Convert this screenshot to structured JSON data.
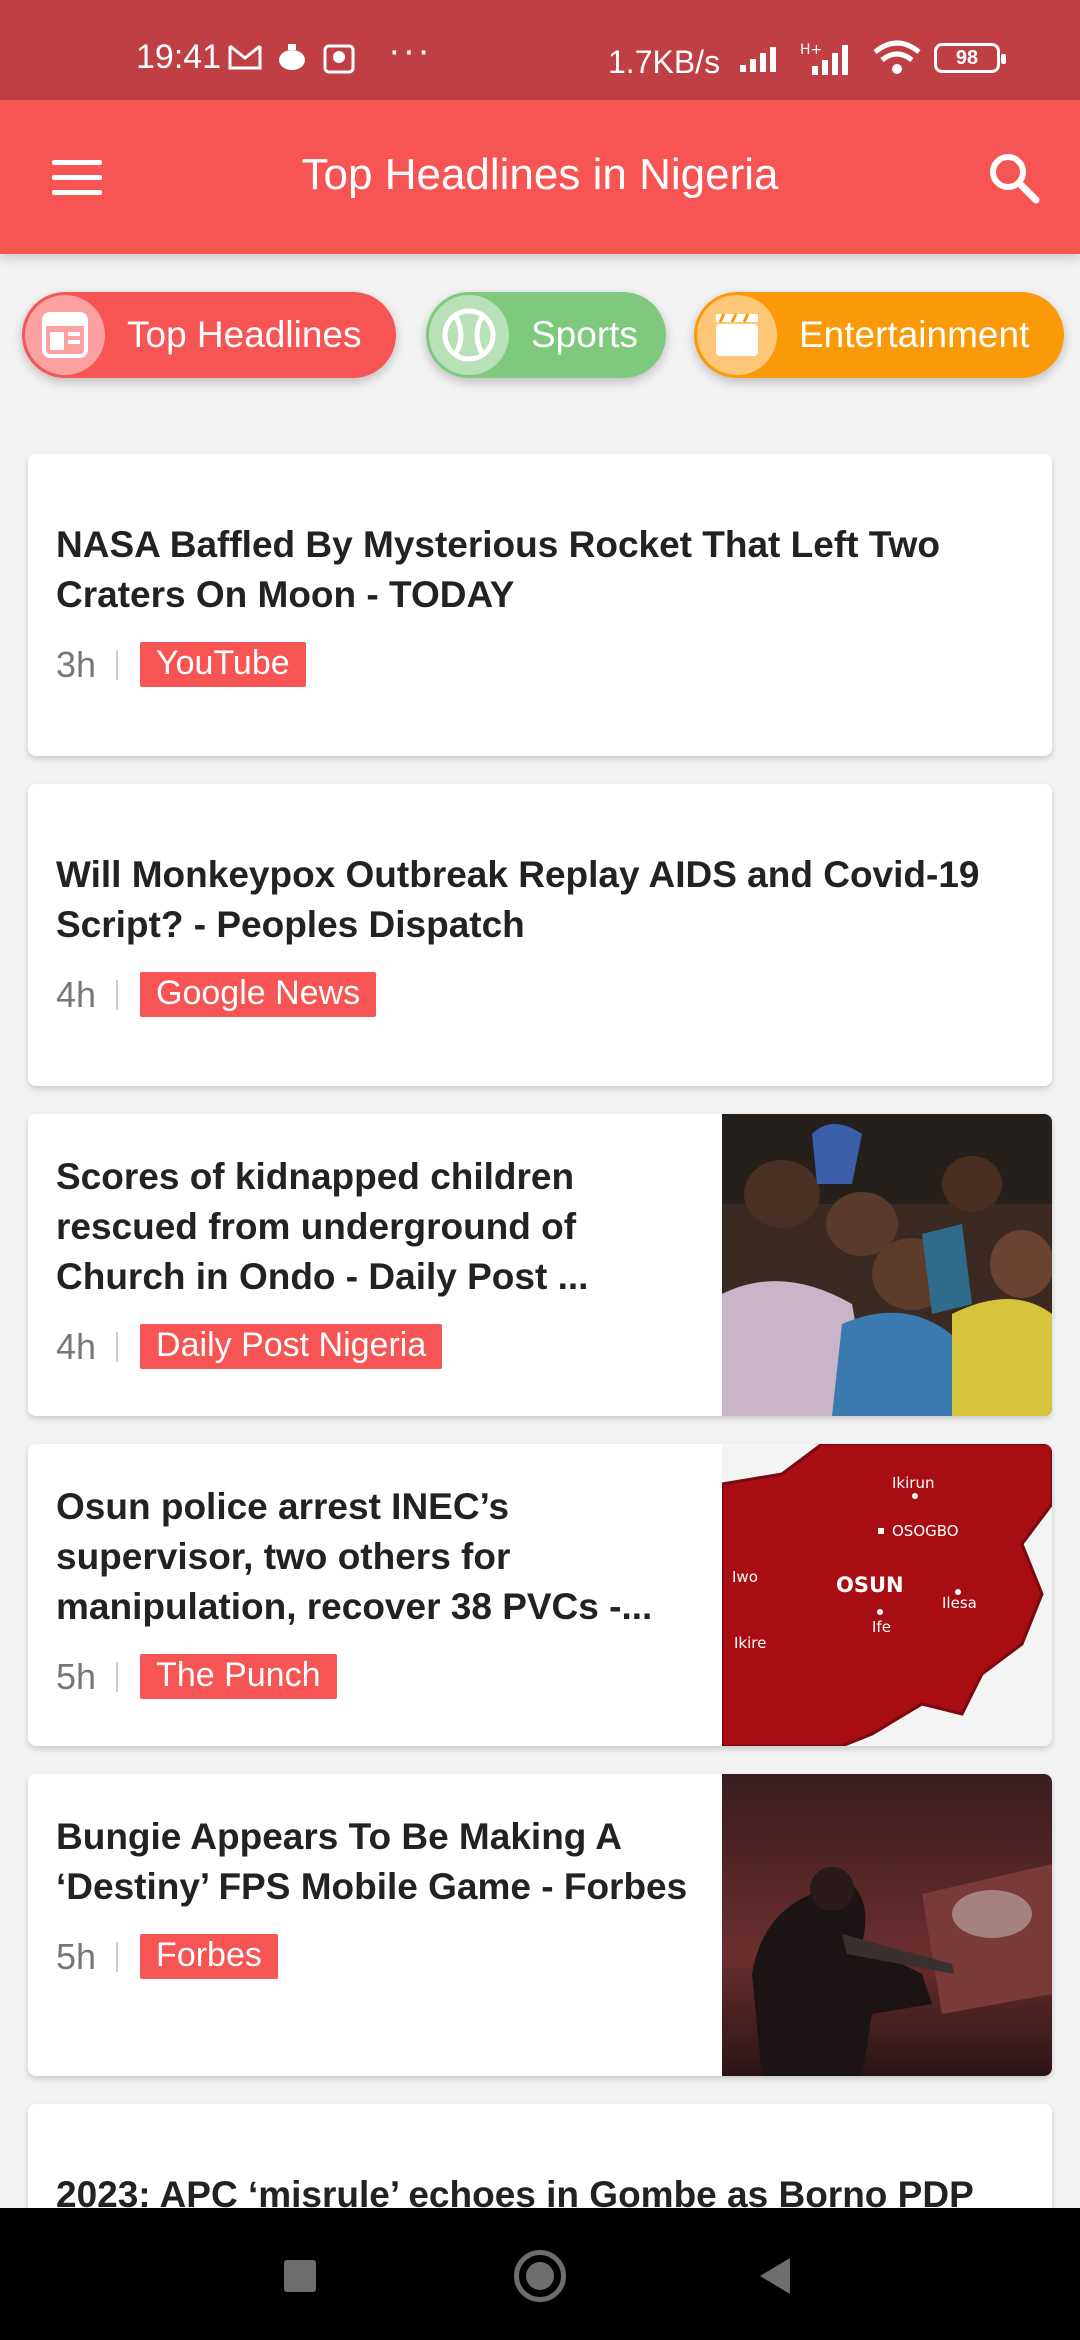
{
  "status_bar": {
    "time": "19:41",
    "more": "···",
    "net_speed": "1.7KB/s",
    "battery": "98",
    "icons": [
      "gmail-icon",
      "notification-icon",
      "app-notification-icon",
      "signal-icon",
      "h-plus-signal-icon",
      "wifi-icon",
      "battery-icon"
    ]
  },
  "app_bar": {
    "title": "Top Headlines in Nigeria",
    "menu_icon": "hamburger-menu-icon",
    "search_icon": "search-icon"
  },
  "categories": [
    {
      "label": "Top Headlines",
      "icon": "newspaper-icon",
      "color": "#f75454"
    },
    {
      "label": "Sports",
      "icon": "ball-icon",
      "color": "#7fc97f"
    },
    {
      "label": "Entertainment",
      "icon": "clapperboard-icon",
      "color": "#fb9a08"
    }
  ],
  "articles": [
    {
      "headline": "NASA Baffled By Mysterious Rocket That Left Two Craters On Moon - TODAY",
      "time": "3h",
      "source": "YouTube"
    },
    {
      "headline": "Will Monkeypox Outbreak Replay AIDS and Covid-19 Script? - Peoples Dispatch",
      "time": "4h",
      "source": "Google News"
    },
    {
      "headline": "Scores of kidnapped children rescued from underground of Church in Ondo - Daily Post ...",
      "time": "4h",
      "source": "Daily Post Nigeria"
    },
    {
      "headline": "Osun police arrest INEC’s supervisor, two others for manipulation, recover 38 PVCs -...",
      "time": "5h",
      "source": "The Punch"
    },
    {
      "headline": "Bungie Appears To Be Making A ‘Destiny’ FPS Mobile Game - Forbes",
      "time": "5h",
      "source": "Forbes"
    },
    {
      "headline": "2023: APC ‘misrule’ echoes in Gombe as Borno PDP",
      "time": "",
      "source": ""
    }
  ],
  "map_labels": {
    "a": "Ikirun",
    "b": "OSOGBO",
    "c": "Iwo",
    "d": "OSUN",
    "e": "Ilesa",
    "f": "Ife",
    "g": "Ikire"
  },
  "colors": {
    "status_bar": "#bf3f45",
    "accent": "#f75454",
    "sports": "#7fc97f",
    "entertainment": "#fb9a08"
  }
}
